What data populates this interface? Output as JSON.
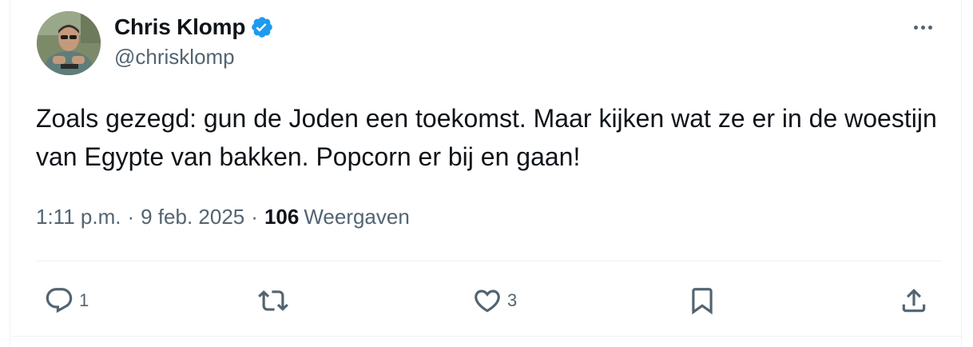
{
  "author": {
    "display_name": "Chris Klomp",
    "handle": "@chrisklomp",
    "verified": true,
    "verified_color": "#1d9bf0"
  },
  "tweet": {
    "text": "Zoals gezegd: gun de Joden een toekomst. Maar kijken wat ze er in de woestijn van Egypte van bakken. Popcorn er bij en gaan!",
    "time": "1:11 p.m.",
    "date": "9 feb. 2025",
    "separator": "·",
    "views_count": "106",
    "views_label": "Weergaven"
  },
  "actions": {
    "reply": {
      "icon": "reply-icon",
      "count": "1"
    },
    "retweet": {
      "icon": "retweet-icon",
      "count": ""
    },
    "like": {
      "icon": "heart-icon",
      "count": "3"
    },
    "bookmark": {
      "icon": "bookmark-icon",
      "count": ""
    },
    "share": {
      "icon": "share-icon",
      "count": ""
    }
  },
  "colors": {
    "text_primary": "#0f1419",
    "text_secondary": "#536471",
    "border": "#eff3f4"
  }
}
